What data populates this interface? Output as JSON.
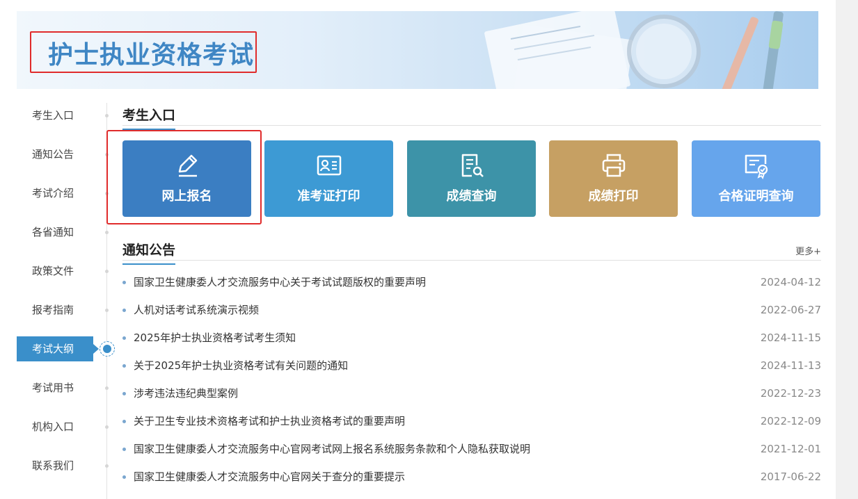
{
  "banner": {
    "title": "护士执业资格考试"
  },
  "sidebar": {
    "items": [
      {
        "label": "考生入口"
      },
      {
        "label": "通知公告"
      },
      {
        "label": "考试介绍"
      },
      {
        "label": "各省通知"
      },
      {
        "label": "政策文件"
      },
      {
        "label": "报考指南"
      },
      {
        "label": "考试大纲",
        "active": true
      },
      {
        "label": "考试用书"
      },
      {
        "label": "机构入口"
      },
      {
        "label": "联系我们"
      }
    ]
  },
  "entry": {
    "title": "考生入口",
    "tiles": [
      {
        "label": "网上报名",
        "icon": "pencil-icon",
        "color": "#3b7ec2"
      },
      {
        "label": "准考证打印",
        "icon": "id-card-icon",
        "color": "#3d9ad4"
      },
      {
        "label": "成绩查询",
        "icon": "document-search-icon",
        "color": "#3d93a8"
      },
      {
        "label": "成绩打印",
        "icon": "printer-icon",
        "color": "#c6a063"
      },
      {
        "label": "合格证明查询",
        "icon": "certificate-icon",
        "color": "#66a5ec"
      }
    ]
  },
  "notices": {
    "title": "通知公告",
    "more": "更多+",
    "items": [
      {
        "title": "国家卫生健康委人才交流服务中心关于考试试题版权的重要声明",
        "date": "2024-04-12"
      },
      {
        "title": "人机对话考试系统演示视频",
        "date": "2022-06-27"
      },
      {
        "title": "2025年护士执业资格考试考生须知",
        "date": "2024-11-15"
      },
      {
        "title": "关于2025年护士执业资格考试有关问题的通知",
        "date": "2024-11-13"
      },
      {
        "title": "涉考违法违纪典型案例",
        "date": "2022-12-23"
      },
      {
        "title": "关于卫生专业技术资格考试和护士执业资格考试的重要声明",
        "date": "2022-12-09"
      },
      {
        "title": "国家卫生健康委人才交流服务中心官网考试网上报名系统服务条款和个人隐私获取说明",
        "date": "2021-12-01"
      },
      {
        "title": "国家卫生健康委人才交流服务中心官网关于查分的重要提示",
        "date": "2017-06-22"
      }
    ]
  }
}
